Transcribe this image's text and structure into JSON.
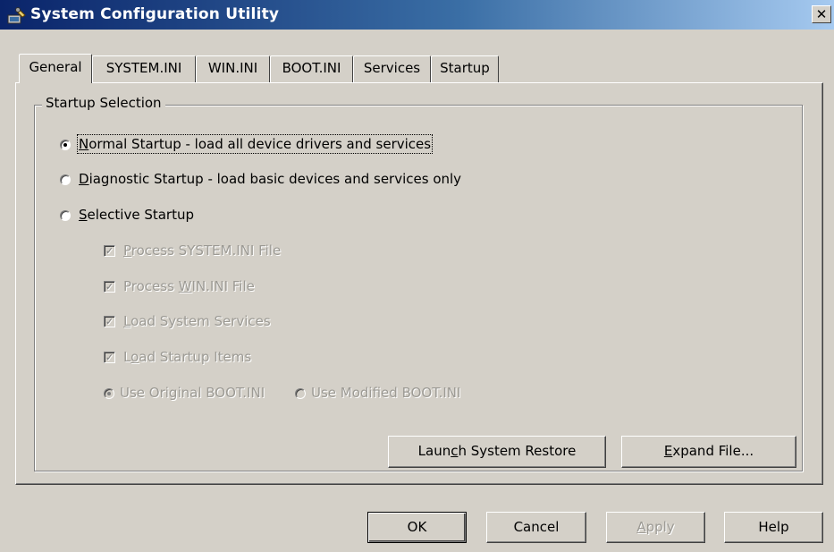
{
  "window": {
    "title": "System Configuration Utility",
    "close_glyph": "✕"
  },
  "tabs": [
    {
      "label": "General",
      "active": true
    },
    {
      "label": "SYSTEM.INI",
      "active": false
    },
    {
      "label": "WIN.INI",
      "active": false
    },
    {
      "label": "BOOT.INI",
      "active": false
    },
    {
      "label": "Services",
      "active": false
    },
    {
      "label": "Startup",
      "active": false
    }
  ],
  "startup_selection": {
    "legend": "Startup Selection",
    "normal": {
      "mnemonic": "N",
      "label": "ormal Startup - load all device drivers and services",
      "selected": true
    },
    "diagnostic": {
      "mnemonic": "D",
      "label": "iagnostic Startup - load basic devices and services only",
      "selected": false
    },
    "selective": {
      "mnemonic": "S",
      "label": "elective Startup",
      "selected": false
    },
    "selective_options": {
      "system_ini": {
        "pre": "",
        "mnemonic": "P",
        "post": "rocess SYSTEM.INI File",
        "checked": true
      },
      "win_ini": {
        "pre": "Process ",
        "mnemonic": "W",
        "post": "IN.INI File",
        "checked": true
      },
      "services": {
        "pre": "",
        "mnemonic": "L",
        "post": "oad System Services",
        "checked": true
      },
      "startup_items": {
        "pre": "L",
        "mnemonic": "o",
        "post": "ad Startup Items",
        "checked": true
      },
      "original_boot": {
        "label": "Use Original BOOT.INI",
        "selected": true
      },
      "modified_boot": {
        "label": "Use Modified BOOT.INI",
        "selected": false
      }
    },
    "launch_restore": {
      "pre": "Laun",
      "mnemonic": "c",
      "post": "h System Restore"
    },
    "expand_file": {
      "pre": "",
      "mnemonic": "E",
      "post": "xpand File..."
    }
  },
  "footer": {
    "ok": "OK",
    "cancel": "Cancel",
    "apply": {
      "mnemonic": "A",
      "post": "pply"
    },
    "help": "Help"
  },
  "colors": {
    "dialog_face": "#d4d0c8",
    "title_active": "#0a246a",
    "disabled_text": "#9c9a94"
  }
}
